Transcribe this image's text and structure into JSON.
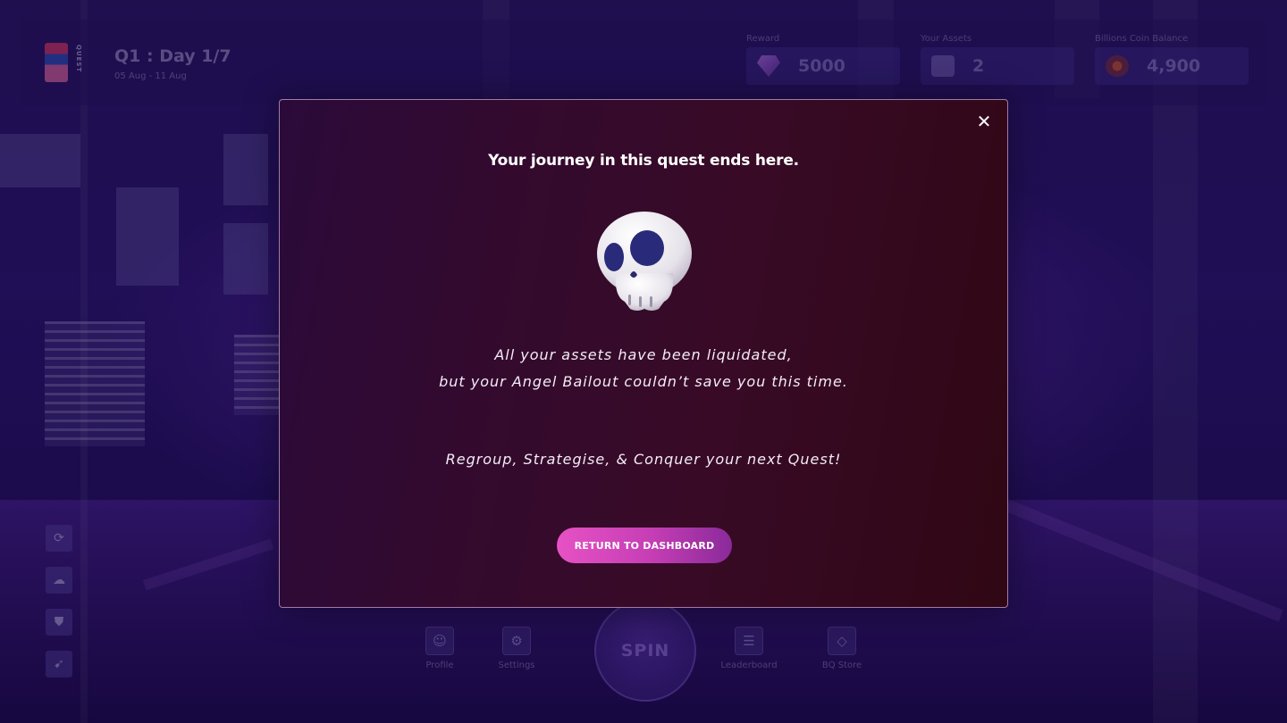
{
  "header": {
    "logo_text": "QUEST",
    "day_title": "Q1 : Day 1/7",
    "date_range": "05 Aug - 11 Aug",
    "stats": [
      {
        "label": "Reward",
        "value": "5000",
        "icon": "diamond-icon"
      },
      {
        "label": "Your Assets",
        "value": "2",
        "icon": "cards-icon"
      },
      {
        "label": "Billions Coin Balance",
        "value": "4,900",
        "icon": "coin-icon"
      }
    ]
  },
  "left_rail": [
    {
      "icon": "refresh-icon",
      "glyph": "⟳"
    },
    {
      "icon": "cloud-icon",
      "glyph": "☁"
    },
    {
      "icon": "shield-icon",
      "glyph": "⛊"
    },
    {
      "icon": "rocket-icon",
      "glyph": "➹"
    }
  ],
  "bottom_nav": {
    "items": [
      {
        "label": "Profile",
        "icon": "profile-icon",
        "glyph": "☺"
      },
      {
        "label": "Settings",
        "icon": "gear-icon",
        "glyph": "⚙"
      },
      {
        "label": "Leaderboard",
        "icon": "list-icon",
        "glyph": "☰"
      },
      {
        "label": "BQ Store",
        "icon": "diamond-icon",
        "glyph": "◇"
      }
    ],
    "spin_label": "SPIN"
  },
  "modal": {
    "title": "Your journey in this quest ends here.",
    "line1": "All your assets have been liquidated,",
    "line2": "but your Angel Bailout couldn’t save you this time.",
    "line3": "Regroup, Strategise, & Conquer your next Quest!",
    "cta_label": "RETURN TO DASHBOARD",
    "close_glyph": "✕",
    "skull_icon": "skull-icon"
  },
  "colors": {
    "accent": "#e652c4",
    "modal_bg": "#330a2e",
    "background": "#2a1566"
  }
}
